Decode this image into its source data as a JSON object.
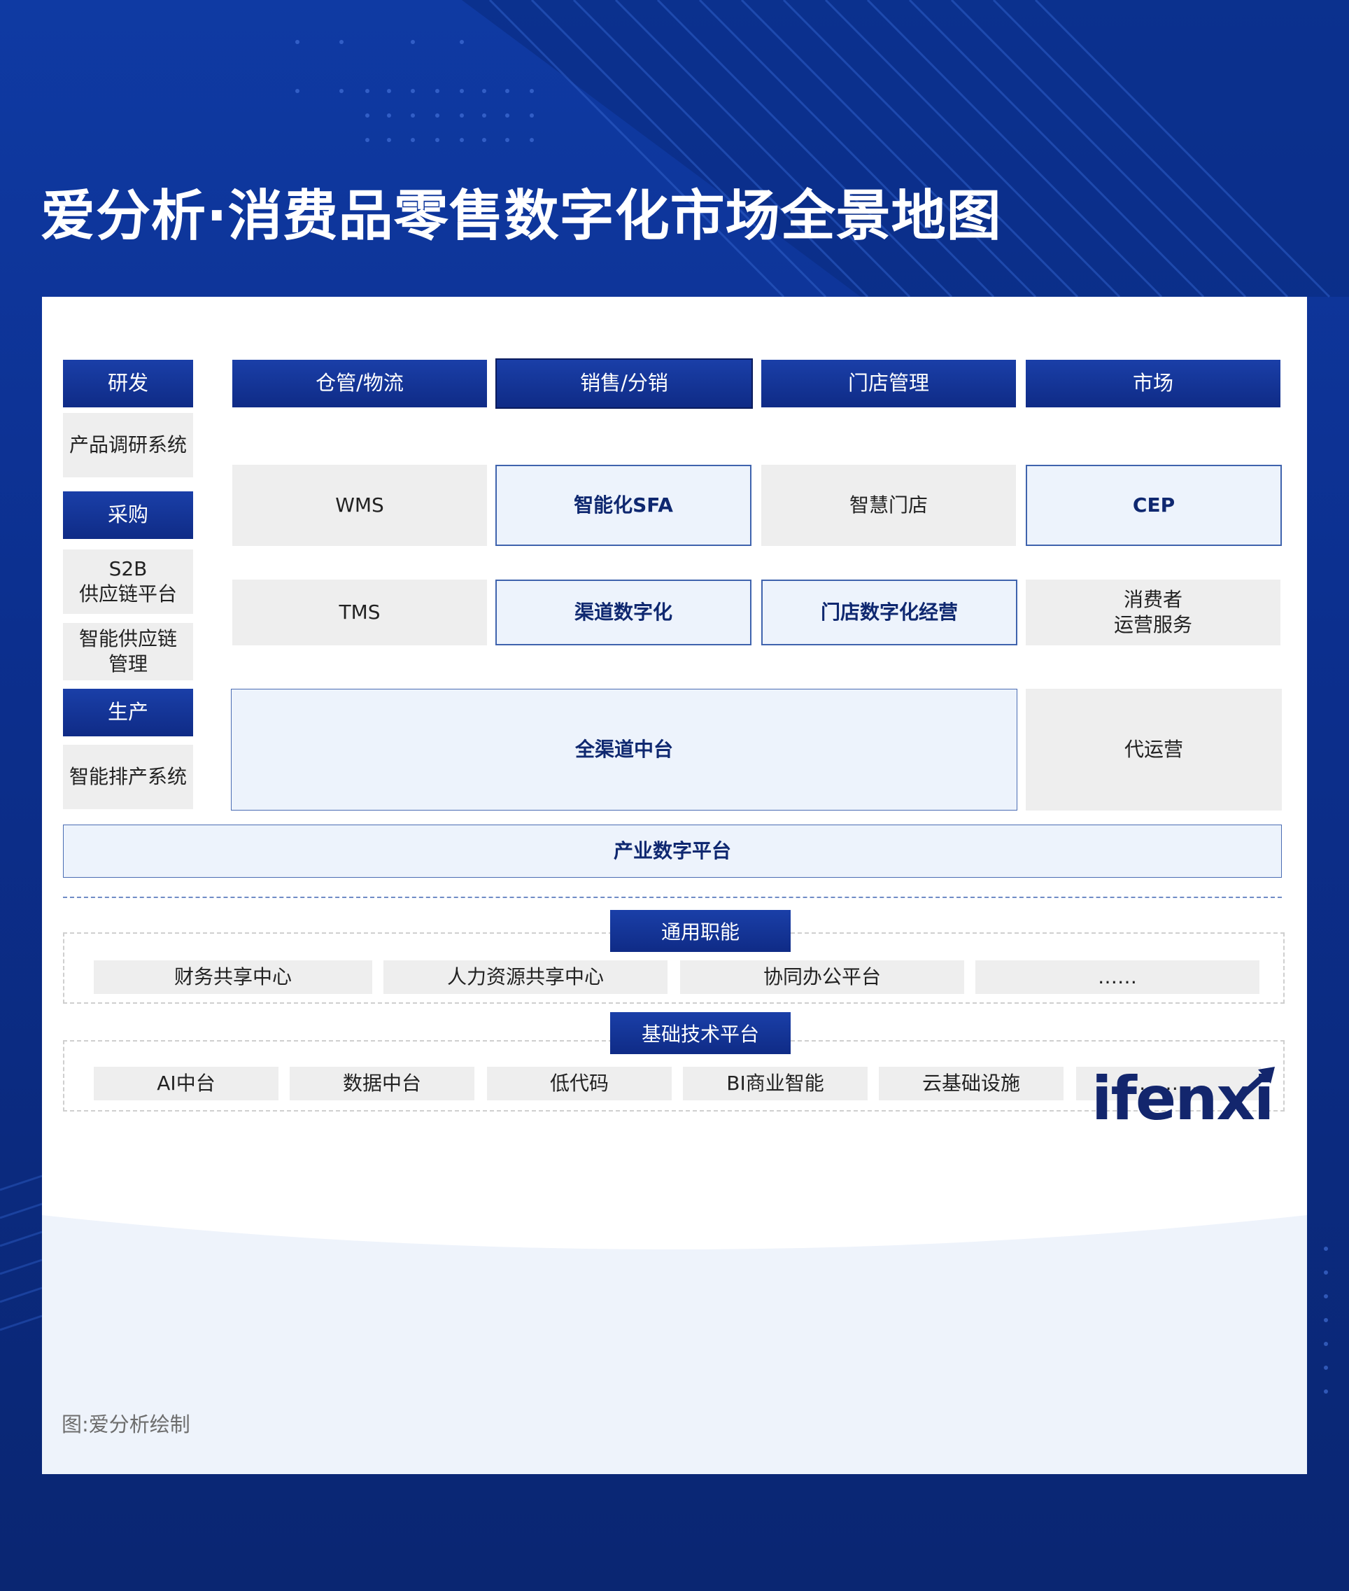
{
  "title": "爱分析·消费品零售数字化市场全景地图",
  "headers": {
    "rd": "研发",
    "warehouse": "仓管/物流",
    "sales": "销售/分销",
    "store": "门店管理",
    "market": "市场",
    "purchase": "采购",
    "production": "生产"
  },
  "left_column": {
    "product_research": "产品调研系统",
    "s2b_line1": "S2B",
    "s2b_line2": "供应链平台",
    "smart_supply_line1": "智能供应链",
    "smart_supply_line2": "管理",
    "smart_scheduling": "智能排产系统"
  },
  "grid": {
    "wms": "WMS",
    "tms": "TMS",
    "smart_sfa": "智能化SFA",
    "channel_digital": "渠道数字化",
    "smart_store": "智慧门店",
    "store_digital_ops": "门店数字化经营",
    "cep": "CEP",
    "consumer_ops_line1": "消费者",
    "consumer_ops_line2": "运营服务",
    "omnichannel_platform": "全渠道中台",
    "agency_ops": "代运营",
    "industry_platform": "产业数字平台"
  },
  "general": {
    "label": "通用职能",
    "items": [
      "财务共享中心",
      "人力资源共享中心",
      "协同办公平台",
      "……"
    ]
  },
  "infra": {
    "label": "基础技术平台",
    "items": [
      "AI中台",
      "数据中台",
      "低代码",
      "BI商业智能",
      "云基础设施",
      "………"
    ]
  },
  "source": "图:爱分析绘制",
  "logo": "ifenxi",
  "colors": {
    "header_blue": "#13318f",
    "highlight_fill": "#edf3fc",
    "highlight_border": "#3f63ad",
    "grey_fill": "#eeeeee"
  }
}
